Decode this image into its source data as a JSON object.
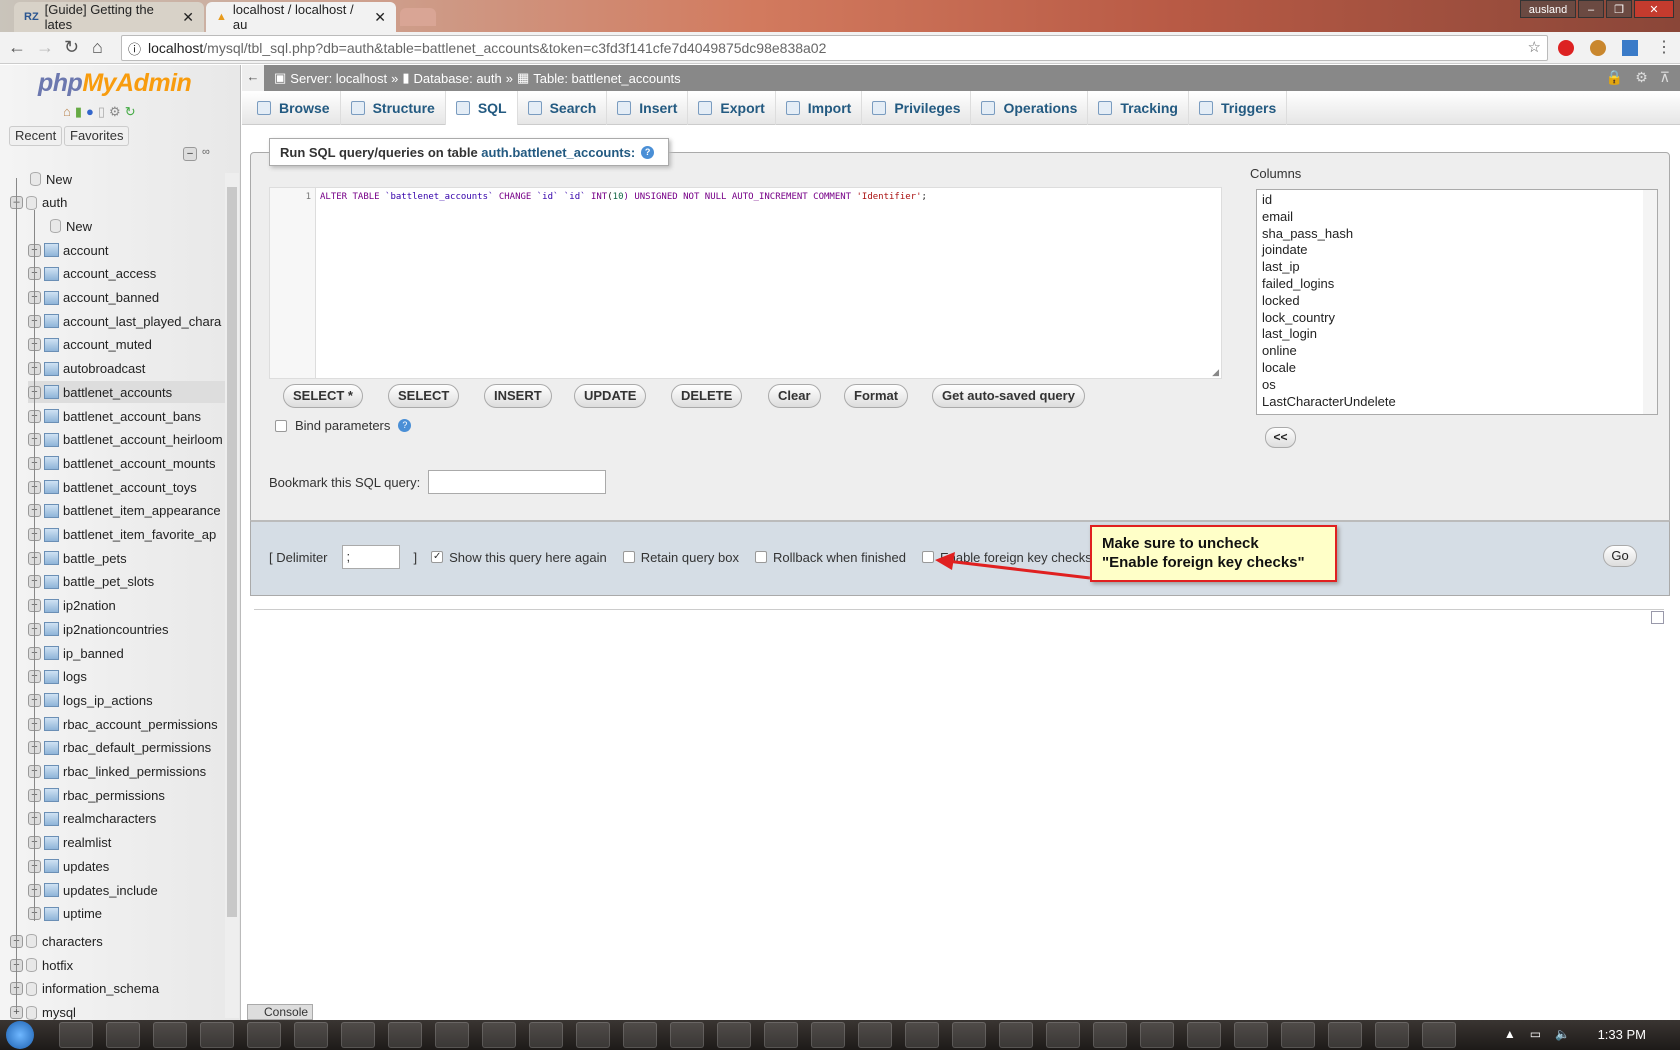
{
  "browser": {
    "tabs": [
      {
        "title": "[Guide] Getting the lates",
        "icon": "rz-icon"
      },
      {
        "title": "localhost / localhost / au",
        "icon": "pma-icon",
        "active": true
      }
    ],
    "user_badge": "ausland",
    "url_host": "localhost",
    "url_path": "/mysql/tbl_sql.php?db=auth&table=battlenet_accounts&token=c3fd3f141cfe7d4049875dc98e838a02"
  },
  "sidebar": {
    "logo": "phpMyAdmin",
    "logo_php": "php",
    "logo_mya": "MyAdmin",
    "recent": "Recent",
    "favorites": "Favorites",
    "new_db": "New",
    "db": "auth",
    "new_table": "New",
    "tables": [
      "account",
      "account_access",
      "account_banned",
      "account_last_played_chara",
      "account_muted",
      "autobroadcast",
      "battlenet_accounts",
      "battlenet_account_bans",
      "battlenet_account_heirloom",
      "battlenet_account_mounts",
      "battlenet_account_toys",
      "battlenet_item_appearance",
      "battlenet_item_favorite_ap",
      "battle_pets",
      "battle_pet_slots",
      "ip2nation",
      "ip2nationcountries",
      "ip_banned",
      "logs",
      "logs_ip_actions",
      "rbac_account_permissions",
      "rbac_default_permissions",
      "rbac_linked_permissions",
      "rbac_permissions",
      "realmcharacters",
      "realmlist",
      "updates",
      "updates_include",
      "uptime"
    ],
    "selected_table": "battlenet_accounts",
    "other_dbs": [
      "characters",
      "hotfix",
      "information_schema",
      "mysql"
    ]
  },
  "breadcrumb": {
    "server": "Server: localhost",
    "database": "Database: auth",
    "table": "Table: battlenet_accounts",
    "sep": "»"
  },
  "tabs": [
    {
      "label": "Browse"
    },
    {
      "label": "Structure"
    },
    {
      "label": "SQL",
      "active": true
    },
    {
      "label": "Search"
    },
    {
      "label": "Insert"
    },
    {
      "label": "Export"
    },
    {
      "label": "Import"
    },
    {
      "label": "Privileges"
    },
    {
      "label": "Operations"
    },
    {
      "label": "Tracking"
    },
    {
      "label": "Triggers"
    }
  ],
  "query": {
    "legend_prefix": "Run SQL query/queries on table ",
    "legend_table": "auth.battlenet_accounts:",
    "line_no": "1",
    "code": [
      {
        "t": "ALTER TABLE ",
        "c": "kw"
      },
      {
        "t": "`battlenet_accounts`",
        "c": "id"
      },
      {
        "t": " CHANGE ",
        "c": "kw"
      },
      {
        "t": "`id` `id`",
        "c": "id"
      },
      {
        "t": " INT",
        "c": "kw"
      },
      {
        "t": "(",
        "c": ""
      },
      {
        "t": "10",
        "c": "num"
      },
      {
        "t": ") UNSIGNED NOT NULL AUTO_INCREMENT COMMENT ",
        "c": "kw"
      },
      {
        "t": "'Identifier'",
        "c": "str"
      },
      {
        "t": ";",
        "c": ""
      }
    ],
    "buttons": [
      "SELECT *",
      "SELECT",
      "INSERT",
      "UPDATE",
      "DELETE",
      "Clear",
      "Format",
      "Get auto-saved query"
    ],
    "bind_params": "Bind parameters",
    "bookmark_label": "Bookmark this SQL query:",
    "bookmark_value": ""
  },
  "columns": {
    "label": "Columns",
    "items": [
      "id",
      "email",
      "sha_pass_hash",
      "joindate",
      "last_ip",
      "failed_logins",
      "locked",
      "lock_country",
      "last_login",
      "online",
      "locale",
      "os",
      "LastCharacterUndelete"
    ],
    "insert_button": "<<"
  },
  "options": {
    "delimiter_label": "[ Delimiter",
    "delimiter_value": ";",
    "delimiter_close": "]",
    "checks": [
      {
        "label": "Show this query here again",
        "checked": true
      },
      {
        "label": "Retain query box",
        "checked": false
      },
      {
        "label": "Rollback when finished",
        "checked": false
      },
      {
        "label": "Enable foreign key checks",
        "checked": false
      }
    ],
    "go": "Go"
  },
  "annotation": {
    "line1": "Make sure to uncheck",
    "line2": "\"Enable foreign key checks\"",
    "color": "#e02020"
  },
  "console": "Console",
  "taskbar": {
    "time": "1:33 PM"
  }
}
